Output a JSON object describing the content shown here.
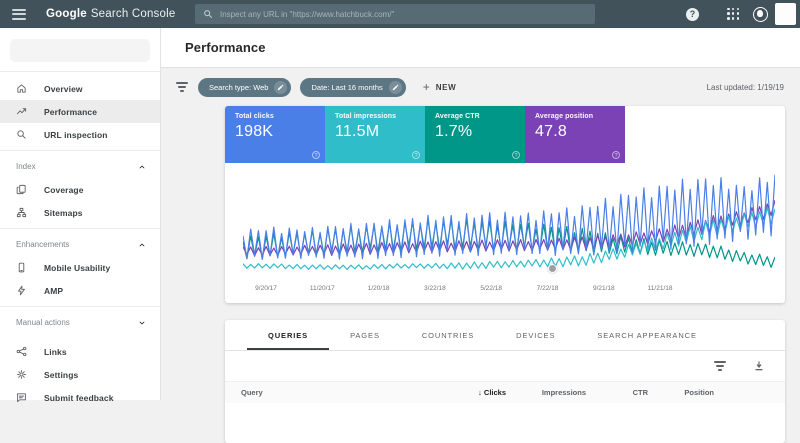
{
  "topbar": {
    "logo_bold": "Google",
    "logo_rest": "Search Console",
    "search_placeholder": "Inspect any URL in \"https://www.hatchbuck.com/\""
  },
  "sidebar": {
    "items": [
      {
        "type": "item",
        "label": "Overview",
        "icon": "home-icon",
        "active": false
      },
      {
        "type": "item",
        "label": "Performance",
        "icon": "performance-icon",
        "active": true
      },
      {
        "type": "item",
        "label": "URL inspection",
        "icon": "url-inspection-icon",
        "active": false
      },
      {
        "type": "divider"
      },
      {
        "type": "section",
        "label": "Index",
        "chevron": "up"
      },
      {
        "type": "item",
        "label": "Coverage",
        "icon": "coverage-icon",
        "active": false
      },
      {
        "type": "item",
        "label": "Sitemaps",
        "icon": "sitemaps-icon",
        "active": false
      },
      {
        "type": "divider"
      },
      {
        "type": "section",
        "label": "Enhancements",
        "chevron": "up"
      },
      {
        "type": "item",
        "label": "Mobile Usability",
        "icon": "mobile-usability-icon",
        "active": false
      },
      {
        "type": "item",
        "label": "AMP",
        "icon": "amp-icon",
        "active": false
      },
      {
        "type": "divider"
      },
      {
        "type": "section",
        "label": "Manual actions",
        "chevron": "down"
      },
      {
        "type": "gap"
      },
      {
        "type": "item",
        "label": "Links",
        "icon": "links-icon",
        "active": false
      },
      {
        "type": "item",
        "label": "Settings",
        "icon": "settings-icon",
        "active": false
      },
      {
        "type": "item",
        "label": "Submit feedback",
        "icon": "feedback-icon",
        "active": false
      }
    ]
  },
  "header": {
    "title": "Performance"
  },
  "filters": {
    "chips": [
      {
        "label": "Search type: Web"
      },
      {
        "label": "Date: Last 16 months"
      }
    ],
    "new_label": "NEW",
    "last_updated": "Last updated: 1/19/19"
  },
  "metrics": [
    {
      "label": "Total clicks",
      "value": "198K",
      "color": "#4a7fe8"
    },
    {
      "label": "Total impressions",
      "value": "11.5M",
      "color": "#2ebdc9"
    },
    {
      "label": "Average CTR",
      "value": "1.7%",
      "color": "#009688"
    },
    {
      "label": "Average position",
      "value": "47.8",
      "color": "#7a42b5"
    }
  ],
  "chart_data": {
    "type": "line",
    "x_tick_labels": [
      "9/20/17",
      "11/20/17",
      "1/20/18",
      "3/22/18",
      "5/22/18",
      "7/22/18",
      "9/21/18",
      "11/21/18"
    ],
    "weeks": 69,
    "ylim": [
      0,
      1
    ],
    "grid": false,
    "legend": "none (colors match metric tiles)",
    "series": [
      {
        "name": "Average CTR",
        "color": "#009688",
        "trend": [
          0.3,
          0.32,
          0.34,
          0.36,
          0.38,
          0.4,
          0.42,
          0.42,
          0.41,
          0.4,
          0.38,
          0.36,
          0.33,
          0.31,
          0.3,
          0.28,
          0.22,
          0.18
        ],
        "amp": [
          0.1,
          0.11,
          0.11,
          0.12,
          0.12,
          0.13,
          0.13,
          0.13,
          0.13,
          0.12,
          0.12,
          0.11,
          0.08,
          0.07,
          0.06,
          0.06,
          0.05,
          0.05
        ]
      },
      {
        "name": "Average position",
        "color": "#7a42b5",
        "trend": [
          0.28,
          0.28,
          0.29,
          0.29,
          0.3,
          0.31,
          0.32,
          0.32,
          0.33,
          0.33,
          0.34,
          0.35,
          0.37,
          0.4,
          0.45,
          0.52,
          0.58,
          0.66
        ],
        "amp": [
          0.04,
          0.04,
          0.04,
          0.05,
          0.05,
          0.05,
          0.05,
          0.05,
          0.05,
          0.05,
          0.05,
          0.06,
          0.06,
          0.06,
          0.07,
          0.07,
          0.06,
          0.07
        ]
      },
      {
        "name": "Total impressions",
        "color": "#2ebdc9",
        "trend": [
          0.15,
          0.15,
          0.14,
          0.14,
          0.14,
          0.15,
          0.15,
          0.15,
          0.16,
          0.17,
          0.18,
          0.2,
          0.26,
          0.33,
          0.4,
          0.48,
          0.54,
          0.6
        ],
        "amp": [
          0.02,
          0.02,
          0.02,
          0.02,
          0.02,
          0.02,
          0.02,
          0.03,
          0.03,
          0.03,
          0.04,
          0.05,
          0.05,
          0.06,
          0.07,
          0.08,
          0.07,
          0.08
        ]
      },
      {
        "name": "Total clicks",
        "color": "#4a7fe8",
        "trend": [
          0.33,
          0.34,
          0.34,
          0.35,
          0.36,
          0.38,
          0.4,
          0.41,
          0.42,
          0.42,
          0.43,
          0.45,
          0.5,
          0.54,
          0.58,
          0.62,
          0.6,
          0.68
        ],
        "amp": [
          0.13,
          0.14,
          0.13,
          0.15,
          0.16,
          0.17,
          0.18,
          0.18,
          0.19,
          0.18,
          0.2,
          0.22,
          0.26,
          0.28,
          0.3,
          0.3,
          0.24,
          0.28
        ]
      }
    ],
    "annotation_marker": {
      "between_labels": [
        "7/22/18",
        "9/21/18"
      ]
    }
  },
  "tabs": {
    "items": [
      "QUERIES",
      "PAGES",
      "COUNTRIES",
      "DEVICES",
      "SEARCH APPEARANCE"
    ],
    "active_index": 0
  },
  "table": {
    "columns": [
      "Query",
      "Clicks",
      "Impressions",
      "CTR",
      "Position"
    ],
    "sorted_column": "Clicks",
    "sort_arrow": "↓"
  }
}
